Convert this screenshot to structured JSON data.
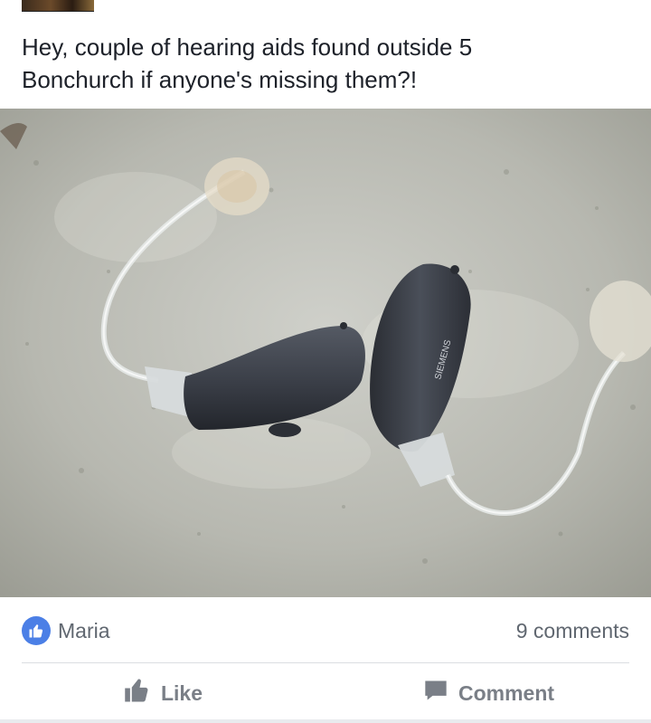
{
  "post": {
    "text": "Hey, couple of hearing aids found outside 5\nBonchurch if anyone's missing them?!",
    "image_alt": "Two grey hearing aids with clear tubes on a concrete surface",
    "brand_text": "SIEMENS"
  },
  "reactions": {
    "reactor_name": "Maria",
    "comments_count": "9 comments"
  },
  "actions": {
    "like_label": "Like",
    "comment_label": "Comment"
  },
  "colors": {
    "like_blue": "#4b7fe6",
    "muted_text": "#606770",
    "action_text": "#7a7f87"
  }
}
